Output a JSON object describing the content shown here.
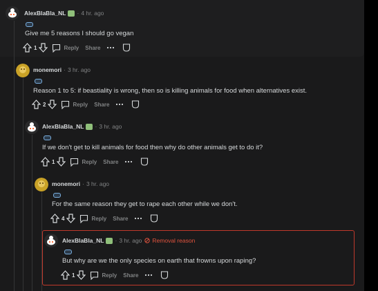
{
  "comments": [
    {
      "username": "AlexBlaBla_NL",
      "time": "4 hr. ago",
      "text": "Give me 5 reasons I should go vegan",
      "votes": "1",
      "reply": "Reply",
      "share": "Share"
    },
    {
      "username": "monemori",
      "time": "3 hr. ago",
      "text": "Reason 1 to 5: if beastiality is wrong, then so is killing animals for food when alternatives exist.",
      "votes": "2",
      "reply": "Reply",
      "share": "Share"
    },
    {
      "username": "AlexBlaBla_NL",
      "time": "3 hr. ago",
      "text": "If we don't get to kill animals for food then why do other animals get to do it?",
      "votes": "1",
      "reply": "Reply",
      "share": "Share"
    },
    {
      "username": "monemori",
      "time": "3 hr. ago",
      "text": "For the same reason they get to rape each other while we don't.",
      "votes": "4",
      "reply": "Reply",
      "share": "Share"
    },
    {
      "username": "AlexBlaBla_NL",
      "time": "3 hr. ago",
      "removal": "Removal reason",
      "text": "But why are we the only species on earth that frowns upon raping?",
      "votes": "1",
      "reply": "Reply",
      "share": "Share"
    }
  ],
  "colors": {
    "removal": "#e0533e",
    "background": "#1a1a1b"
  },
  "icons": [
    "upvote-icon",
    "downvote-icon",
    "comment-icon",
    "more-icon",
    "save-icon",
    "removal-icon"
  ]
}
